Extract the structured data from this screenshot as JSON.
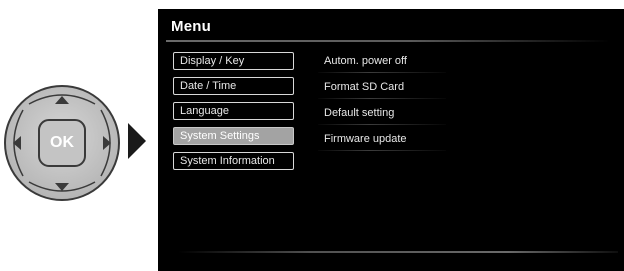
{
  "keypad": {
    "ok_label": "OK"
  },
  "screen": {
    "title": "Menu",
    "menu_items": [
      {
        "label": "Display / Key",
        "selected": false
      },
      {
        "label": "Date / Time",
        "selected": false
      },
      {
        "label": "Language",
        "selected": false
      },
      {
        "label": "System Settings",
        "selected": true
      },
      {
        "label": "System Information",
        "selected": false
      }
    ],
    "submenu_items": [
      {
        "label": "Autom. power off"
      },
      {
        "label": "Format SD Card"
      },
      {
        "label": "Default setting"
      },
      {
        "label": "Firmware update"
      }
    ]
  },
  "colors": {
    "screen_background": "#000000",
    "selected_item": "#a3a3a3",
    "keypad_gray": "#c6c6c6"
  }
}
